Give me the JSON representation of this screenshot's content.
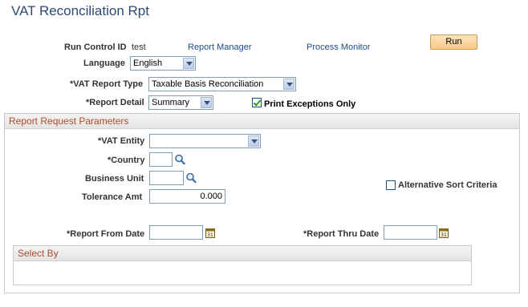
{
  "page": {
    "title": "VAT Reconciliation Rpt"
  },
  "header": {
    "run_control_label": "Run Control ID",
    "run_control_value": "test",
    "report_manager_link": "Report Manager",
    "process_monitor_link": "Process Monitor",
    "run_button": "Run"
  },
  "form": {
    "language_label": "Language",
    "language_value": "English",
    "vat_report_type_label": "*VAT Report Type",
    "vat_report_type_value": "Taxable Basis Reconciliation",
    "report_detail_label": "*Report Detail",
    "report_detail_value": "Summary",
    "print_exceptions_label": "Print Exceptions Only",
    "print_exceptions_checked": true
  },
  "params": {
    "section_title": "Report Request Parameters",
    "vat_entity_label": "*VAT Entity",
    "vat_entity_value": "",
    "country_label": "*Country",
    "country_value": "",
    "business_unit_label": "Business Unit",
    "business_unit_value": "",
    "tolerance_label": "Tolerance Amt",
    "tolerance_value": "0.000",
    "alt_sort_label": "Alternative Sort Criteria",
    "alt_sort_checked": false,
    "from_date_label": "*Report From Date",
    "from_date_value": "",
    "thru_date_label": "*Report Thru Date",
    "thru_date_value": "",
    "select_by_title": "Select By"
  },
  "colors": {
    "title": "#2c4a74",
    "link": "#1b4f8a",
    "section_header_text": "#b04a2a",
    "run_button_bg": "#f8c98a"
  },
  "icons": {
    "lookup": "magnifier-icon",
    "calendar": "calendar-icon",
    "dropdown": "chevron-down-icon",
    "check": "checkmark-icon"
  }
}
